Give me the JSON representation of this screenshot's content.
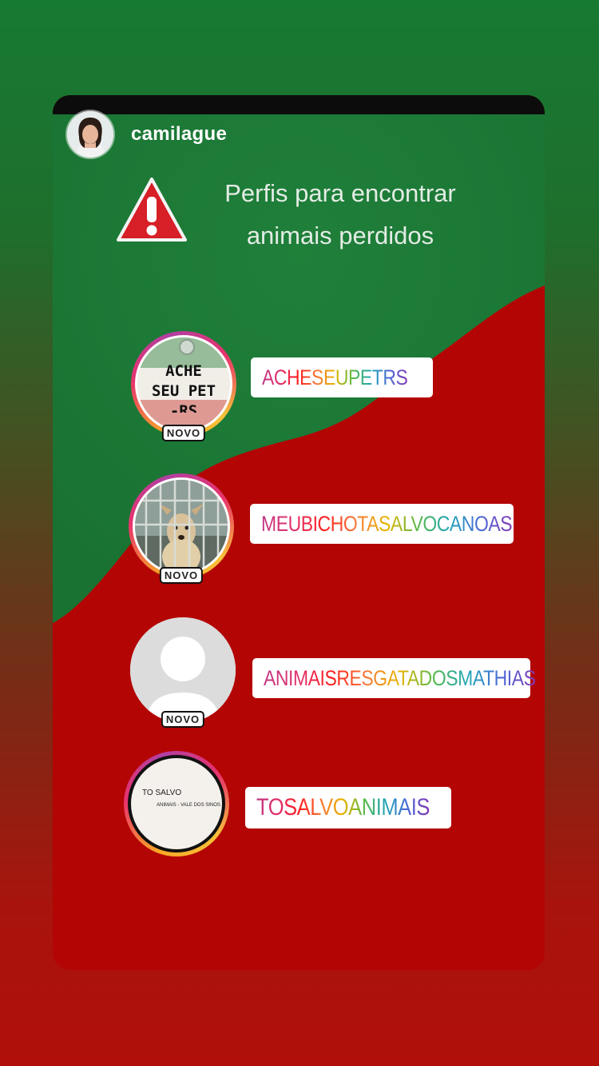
{
  "story": {
    "username": "camilague",
    "title_line1": "Perfis para encontrar",
    "title_line2": "animais perdidos",
    "badge_label": "NOVO"
  },
  "profiles": [
    {
      "handle": "ACHESEUPETRS",
      "pic_text_1": "ACHE",
      "pic_text_2": "SEU PET",
      "pic_text_3": "-RS"
    },
    {
      "handle": "MEUBICHOTASALVOCANOAS"
    },
    {
      "handle": "ANIMAISRESGATADOSMATHIAS"
    },
    {
      "handle": "TOSALVOANIMAIS",
      "pic_text_1": "TO SALVO",
      "pic_text_2": "ANIMAIS - VALE DOS SINOS"
    }
  ],
  "colors": {
    "green": "#1b7a36",
    "red": "#b40505",
    "page_gradient_top": "#177a33",
    "page_gradient_bottom": "#b10f0a"
  }
}
